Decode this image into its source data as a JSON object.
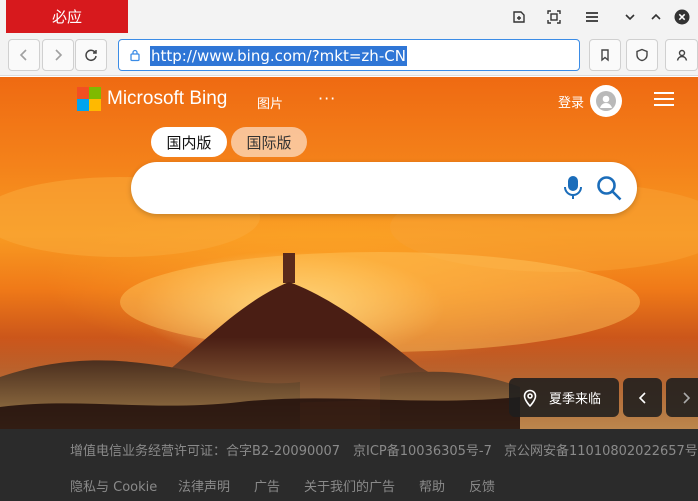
{
  "browser": {
    "tab_title": "必应",
    "url": "http://www.bing.com/?mkt=zh-CN",
    "tab_color": "#d7191d"
  },
  "header": {
    "logo_text": "Microsoft Bing",
    "nav_images": "图片",
    "nav_more": "···",
    "login": "登录"
  },
  "search": {
    "scope_cn": "国内版",
    "scope_intl": "国际版",
    "placeholder": ""
  },
  "image_caption": "夏季来临",
  "footer": {
    "row1": [
      "增值电信业务经营许可证：合字B2-20090007",
      "京ICP备10036305号-7",
      "京公网安备11010802022657号"
    ],
    "row2": [
      "隐私与 Cookie",
      "法律声明",
      "广告",
      "关于我们的广告",
      "帮助",
      "反馈"
    ]
  },
  "colors": {
    "accent": "#3b8ce6",
    "search_icon": "#1b6dba",
    "footer_bg": "#2b2b2b",
    "footer_text": "#8a8a8a"
  }
}
